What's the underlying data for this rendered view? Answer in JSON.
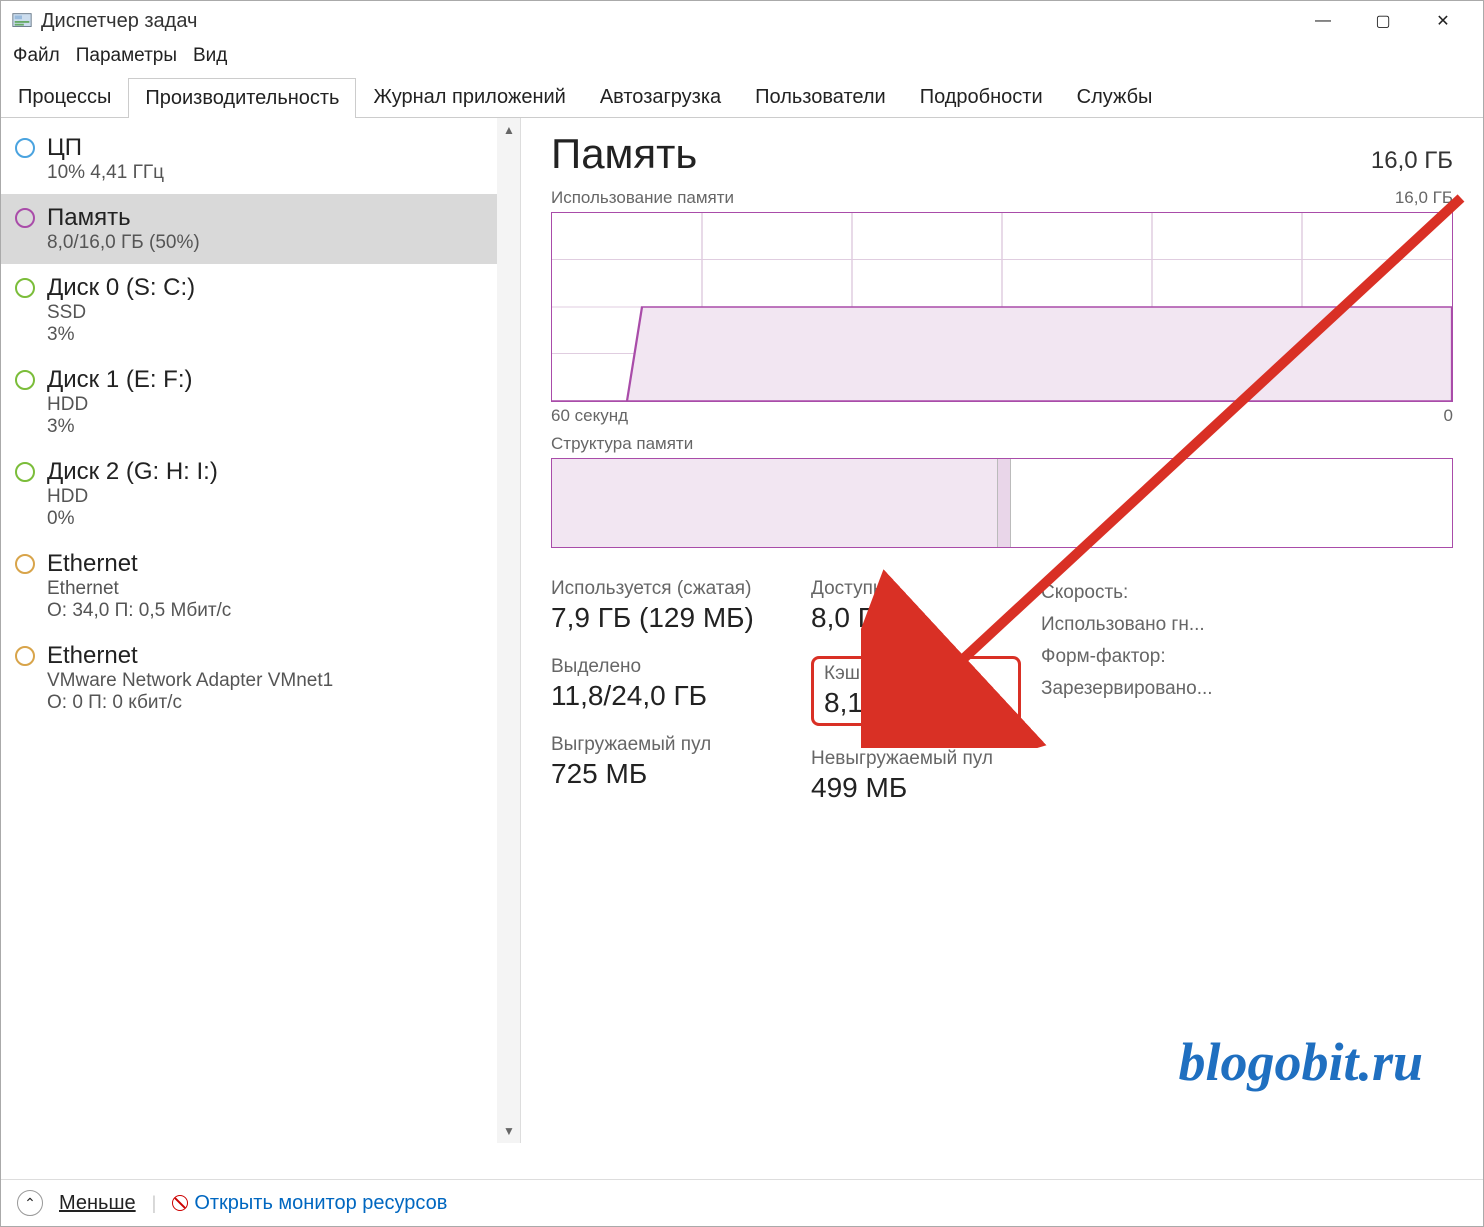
{
  "window": {
    "title": "Диспетчер задач"
  },
  "menu": {
    "file": "Файл",
    "options": "Параметры",
    "view": "Вид"
  },
  "tabs": {
    "processes": "Процессы",
    "performance": "Производительность",
    "apphistory": "Журнал приложений",
    "startup": "Автозагрузка",
    "users": "Пользователи",
    "details": "Подробности",
    "services": "Службы"
  },
  "sidebar": {
    "items": [
      {
        "title": "ЦП",
        "sub1": "10% 4,41 ГГц",
        "sub2": ""
      },
      {
        "title": "Память",
        "sub1": "8,0/16,0 ГБ (50%)",
        "sub2": ""
      },
      {
        "title": "Диск 0 (S: C:)",
        "sub1": "SSD",
        "sub2": "3%"
      },
      {
        "title": "Диск 1 (E: F:)",
        "sub1": "HDD",
        "sub2": "3%"
      },
      {
        "title": "Диск 2 (G: H: I:)",
        "sub1": "HDD",
        "sub2": "0%"
      },
      {
        "title": "Ethernet",
        "sub1": "Ethernet",
        "sub2": "О: 34,0 П: 0,5 Мбит/с"
      },
      {
        "title": "Ethernet",
        "sub1": "VMware Network Adapter VMnet1",
        "sub2": "О: 0 П: 0 кбит/с"
      }
    ]
  },
  "detail": {
    "title": "Память",
    "capacity": "16,0 ГБ",
    "usage_label": "Использование памяти",
    "usage_max": "16,0 ГБ",
    "xaxis_left": "60 секунд",
    "xaxis_right": "0",
    "composition_label": "Структура памяти",
    "stats": {
      "used_label": "Используется (сжатая)",
      "used_value": "7,9 ГБ (129 МБ)",
      "committed_label": "Выделено",
      "committed_value": "11,8/24,0 ГБ",
      "paged_label": "Выгружаемый пул",
      "paged_value": "725 МБ",
      "available_label": "Доступно",
      "available_value": "8,0 ГБ",
      "cached_label": "Кэшировано",
      "cached_value": "8,1 ГБ",
      "nonpaged_label": "Невыгружаемый пул",
      "nonpaged_value": "499 МБ",
      "speed_label": "Скорость:",
      "slots_label": "Использовано гн...",
      "form_label": "Форм-фактор:",
      "reserved_label": "Зарезервировано..."
    }
  },
  "footer": {
    "less": "Меньше",
    "resmon": "Открыть монитор ресурсов"
  },
  "watermark": "blogobit.ru",
  "chart_data": {
    "type": "area",
    "title": "Использование памяти",
    "xlabel": "60 секунд → 0",
    "ylabel": "ГБ",
    "ylim": [
      0,
      16
    ],
    "x": [
      0,
      5,
      6,
      60
    ],
    "values": [
      0,
      0,
      8.0,
      8.0
    ]
  }
}
